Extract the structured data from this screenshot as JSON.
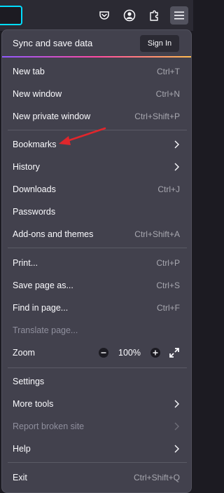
{
  "toolbar": {
    "icons": [
      "pocket-icon",
      "account-icon",
      "extensions-icon",
      "hamburger-menu-icon"
    ]
  },
  "colors": {
    "focus_ring": "#00ddff",
    "arrow": "#e0262c",
    "panel": "#42414d"
  },
  "sync": {
    "label": "Sync and save data",
    "button": "Sign In"
  },
  "menu": {
    "new_tab": {
      "label": "New tab",
      "shortcut": "Ctrl+T"
    },
    "new_window": {
      "label": "New window",
      "shortcut": "Ctrl+N"
    },
    "new_private_window": {
      "label": "New private window",
      "shortcut": "Ctrl+Shift+P"
    },
    "bookmarks": {
      "label": "Bookmarks"
    },
    "history": {
      "label": "History"
    },
    "downloads": {
      "label": "Downloads",
      "shortcut": "Ctrl+J"
    },
    "passwords": {
      "label": "Passwords"
    },
    "addons": {
      "label": "Add-ons and themes",
      "shortcut": "Ctrl+Shift+A"
    },
    "print": {
      "label": "Print...",
      "shortcut": "Ctrl+P"
    },
    "save_page": {
      "label": "Save page as...",
      "shortcut": "Ctrl+S"
    },
    "find": {
      "label": "Find in page...",
      "shortcut": "Ctrl+F"
    },
    "translate": {
      "label": "Translate page..."
    },
    "zoom": {
      "label": "Zoom",
      "level": "100%"
    },
    "settings": {
      "label": "Settings"
    },
    "more_tools": {
      "label": "More tools"
    },
    "report": {
      "label": "Report broken site"
    },
    "help": {
      "label": "Help"
    },
    "exit": {
      "label": "Exit",
      "shortcut": "Ctrl+Shift+Q"
    }
  }
}
